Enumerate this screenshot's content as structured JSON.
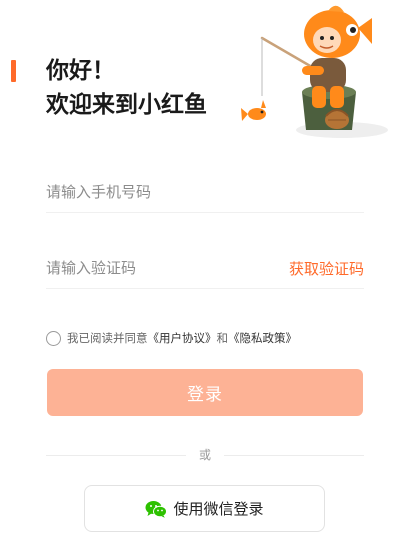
{
  "header": {
    "line1": "你好！",
    "line2": "欢迎来到小红鱼"
  },
  "form": {
    "phone_placeholder": "请输入手机号码",
    "code_placeholder": "请输入验证码",
    "get_code_label": "获取验证码"
  },
  "agreement": {
    "prefix": "我已阅读并同意",
    "user_agreement": "《用户协议》",
    "connector": "和",
    "privacy_policy": "《隐私政策》"
  },
  "login": {
    "label": "登录"
  },
  "divider": {
    "or_label": "或"
  },
  "wechat": {
    "label": "使用微信登录"
  },
  "icons": {
    "mascot": "fishing-fish-mascot",
    "wechat": "wechat-icon",
    "checkbox": "radio-circle"
  },
  "colors": {
    "accent": "#ff6a2a",
    "login_button": "#fdb295",
    "wechat_green": "#2dc100"
  }
}
